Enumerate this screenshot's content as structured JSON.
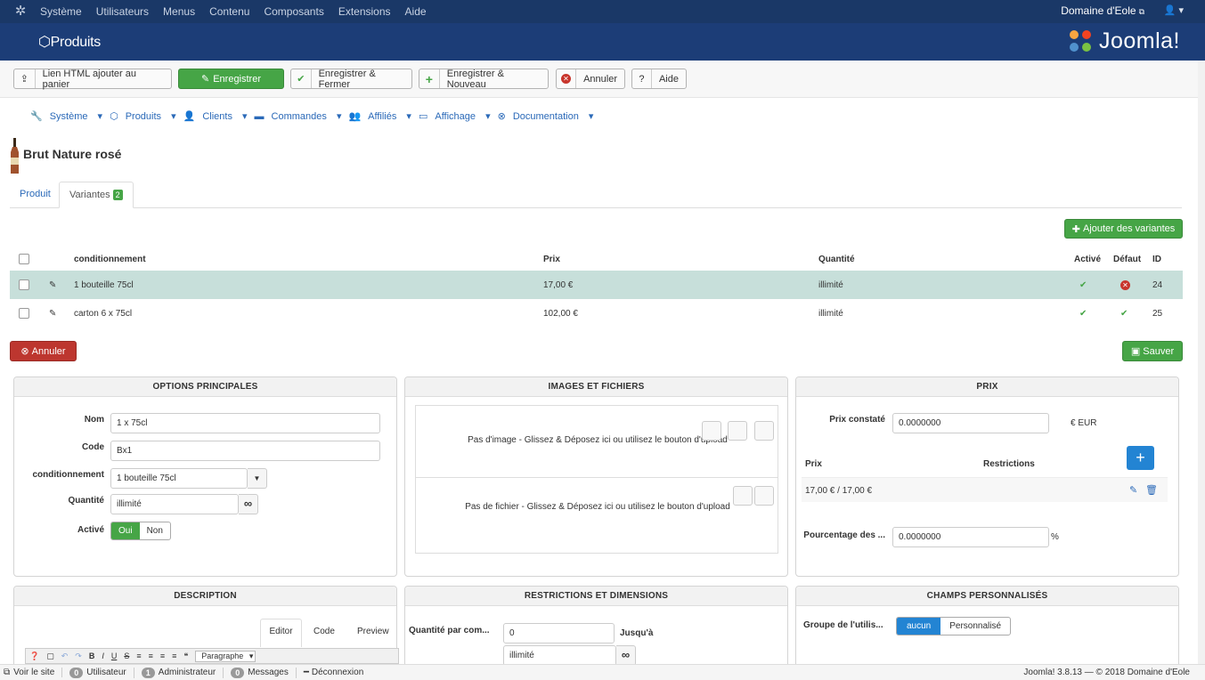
{
  "topbar": {
    "menu": [
      "Système",
      "Utilisateurs",
      "Menus",
      "Contenu",
      "Composants",
      "Extensions",
      "Aide"
    ],
    "site": "Domaine d'Eole"
  },
  "header": {
    "title": "Produits",
    "brand": "Joomla!"
  },
  "toolbar": {
    "html_link": "Lien HTML ajouter au panier",
    "save": "Enregistrer",
    "save_close": "Enregistrer & Fermer",
    "save_new": "Enregistrer & Nouveau",
    "cancel": "Annuler",
    "help": "Aide"
  },
  "submenu": [
    "Système",
    "Produits",
    "Clients",
    "Commandes",
    "Affiliés",
    "Affichage",
    "Documentation"
  ],
  "product": {
    "title": "Brut Nature rosé"
  },
  "tabs": {
    "product": "Produit",
    "variants": "Variantes",
    "variants_count": "2"
  },
  "add_variants": "Ajouter des variantes",
  "table": {
    "headers": {
      "cond": "conditionnement",
      "price": "Prix",
      "qty": "Quantité",
      "active": "Activé",
      "default": "Défaut",
      "id": "ID"
    },
    "rows": [
      {
        "cond": "1 bouteille 75cl",
        "price": "17,00 €",
        "qty": "illimité",
        "id": "24"
      },
      {
        "cond": "carton 6 x 75cl",
        "price": "102,00 €",
        "qty": "illimité",
        "id": "25"
      }
    ]
  },
  "cancel_btn": "Annuler",
  "save_btn": "Sauver",
  "options": {
    "title": "OPTIONS PRINCIPALES",
    "name_label": "Nom",
    "name_value": "1 x 75cl",
    "code_label": "Code",
    "code_value": "Bx1",
    "cond_label": "conditionnement",
    "cond_value": "1 bouteille 75cl",
    "qty_label": "Quantité",
    "qty_value": "illimité",
    "active_label": "Activé",
    "yes": "Oui",
    "no": "Non"
  },
  "images": {
    "title": "IMAGES ET FICHIERS",
    "no_image": "Pas d'image - Glissez & Déposez ici ou utilisez le bouton d'upload",
    "no_file": "Pas de fichier - Glissez & Déposez ici ou utilisez le bouton d'upload"
  },
  "price": {
    "title": "PRIX",
    "observed_label": "Prix constaté",
    "observed_value": "0.0000000",
    "currency": "€ EUR",
    "col_price": "Prix",
    "col_restrictions": "Restrictions",
    "row_price": "17,00 € / 17,00 €",
    "pct_label": "Pourcentage des ...",
    "pct_value": "0.0000000",
    "pct_unit": "%"
  },
  "description": {
    "title": "DESCRIPTION",
    "tab_editor": "Editor",
    "tab_code": "Code",
    "tab_preview": "Preview",
    "format": "Paragraphe"
  },
  "restrictions": {
    "title": "RESTRICTIONS ET DIMENSIONS",
    "qty_label": "Quantité par com...",
    "qty_min": "0",
    "until": "Jusqu'à",
    "qty_max": "illimité"
  },
  "custom": {
    "title": "CHAMPS PERSONNALISÉS",
    "group_label": "Groupe de l'utilis...",
    "none": "aucun",
    "custom": "Personnalisé"
  },
  "statusbar": {
    "view_site": "Voir le site",
    "users_count": "0",
    "users": "Utilisateur",
    "admins_count": "1",
    "admins": "Administrateur",
    "messages_count": "0",
    "messages": "Messages",
    "logout": "Déconnexion",
    "version": "Joomla! 3.8.13 — © 2018 Domaine d'Eole"
  }
}
